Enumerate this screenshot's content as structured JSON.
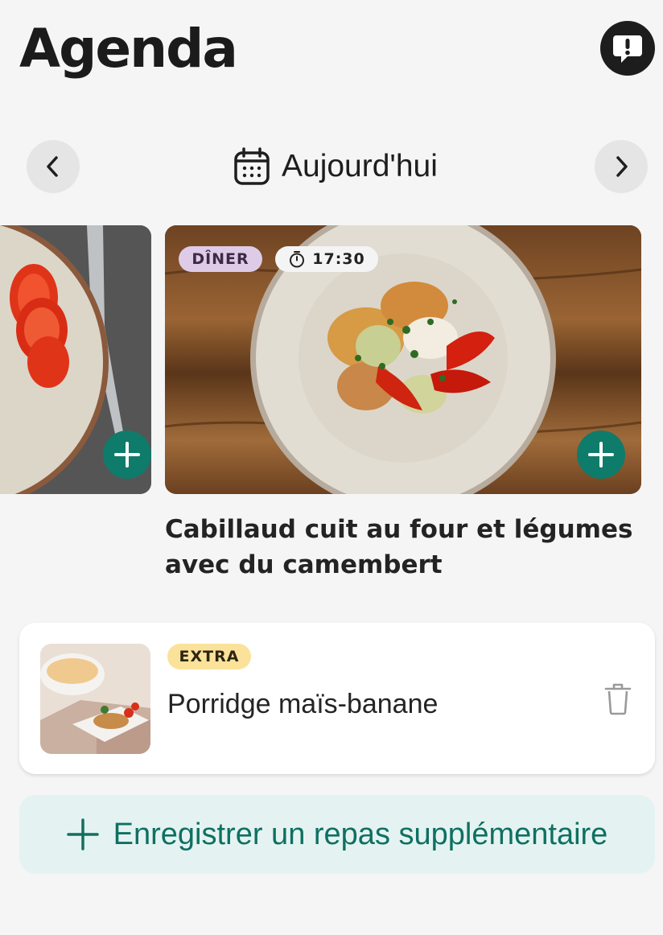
{
  "header": {
    "title": "Agenda",
    "feedback_icon": "feedback-exclamation-icon"
  },
  "date_nav": {
    "label": "Aujourd'hui",
    "prev_icon": "chevron-left-icon",
    "next_icon": "chevron-right-icon",
    "calendar_icon": "calendar-icon"
  },
  "meals": [
    {
      "image": "tomato-plate-photo"
    },
    {
      "type_tag": "DÎNER",
      "time": "17:30",
      "title": "Cabillaud cuit au four et légumes avec du camembert",
      "image": "baked-cod-vegetables-photo"
    }
  ],
  "extra": {
    "tag": "EXTRA",
    "name": "Porridge maïs-banane",
    "image": "porridge-photo"
  },
  "add_extra": {
    "label": "Enregistrer un repas supplémentaire"
  },
  "colors": {
    "accent": "#0f7b6a",
    "diner_tag": "#ddcbe8",
    "extra_tag": "#fbe29a",
    "add_extra_bg": "#e4f3f2"
  }
}
